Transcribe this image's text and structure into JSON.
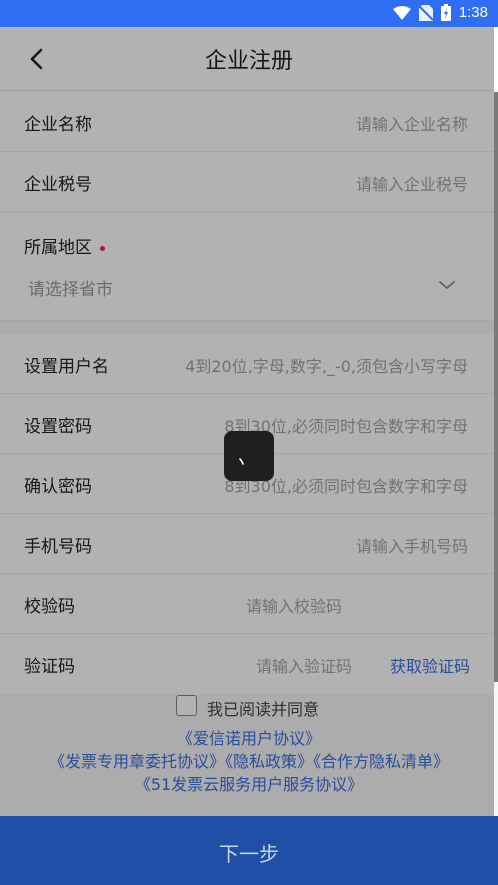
{
  "status_bar": {
    "time": "1:38"
  },
  "nav": {
    "title": "企业注册"
  },
  "form": {
    "company_name": {
      "label": "企业名称",
      "placeholder": "请输入企业名称"
    },
    "tax_id": {
      "label": "企业税号",
      "placeholder": "请输入企业税号"
    },
    "region": {
      "label": "所属地区",
      "placeholder": "请选择省市"
    },
    "username": {
      "label": "设置用户名",
      "placeholder": "4到20位,字母,数字,_-0,须包含小写字母"
    },
    "password": {
      "label": "设置密码",
      "placeholder": "8到30位,必须同时包含数字和字母"
    },
    "confirm_password": {
      "label": "确认密码",
      "placeholder": "8到30位,必须同时包含数字和字母"
    },
    "phone": {
      "label": "手机号码",
      "placeholder": "请输入手机号码"
    },
    "check_code": {
      "label": "校验码",
      "placeholder": "请输入校验码"
    },
    "verify_code": {
      "label": "验证码",
      "placeholder": "请输入验证码",
      "action": "获取验证码"
    }
  },
  "agreement": {
    "text": "我已阅读并同意",
    "links_line1": "《爱信诺用户协议》",
    "links_line2": "《发票专用章委托协议》《隐私政策》《合作方隐私清单》",
    "links_line3": "《51发票云服务用户服务协议》"
  },
  "next_button": {
    "label": "下一步"
  },
  "colors": {
    "status_bar": "#2f6df2",
    "link": "#3d6fe0",
    "primary_button": "#1f4fa6",
    "required": "#e02a4f"
  }
}
